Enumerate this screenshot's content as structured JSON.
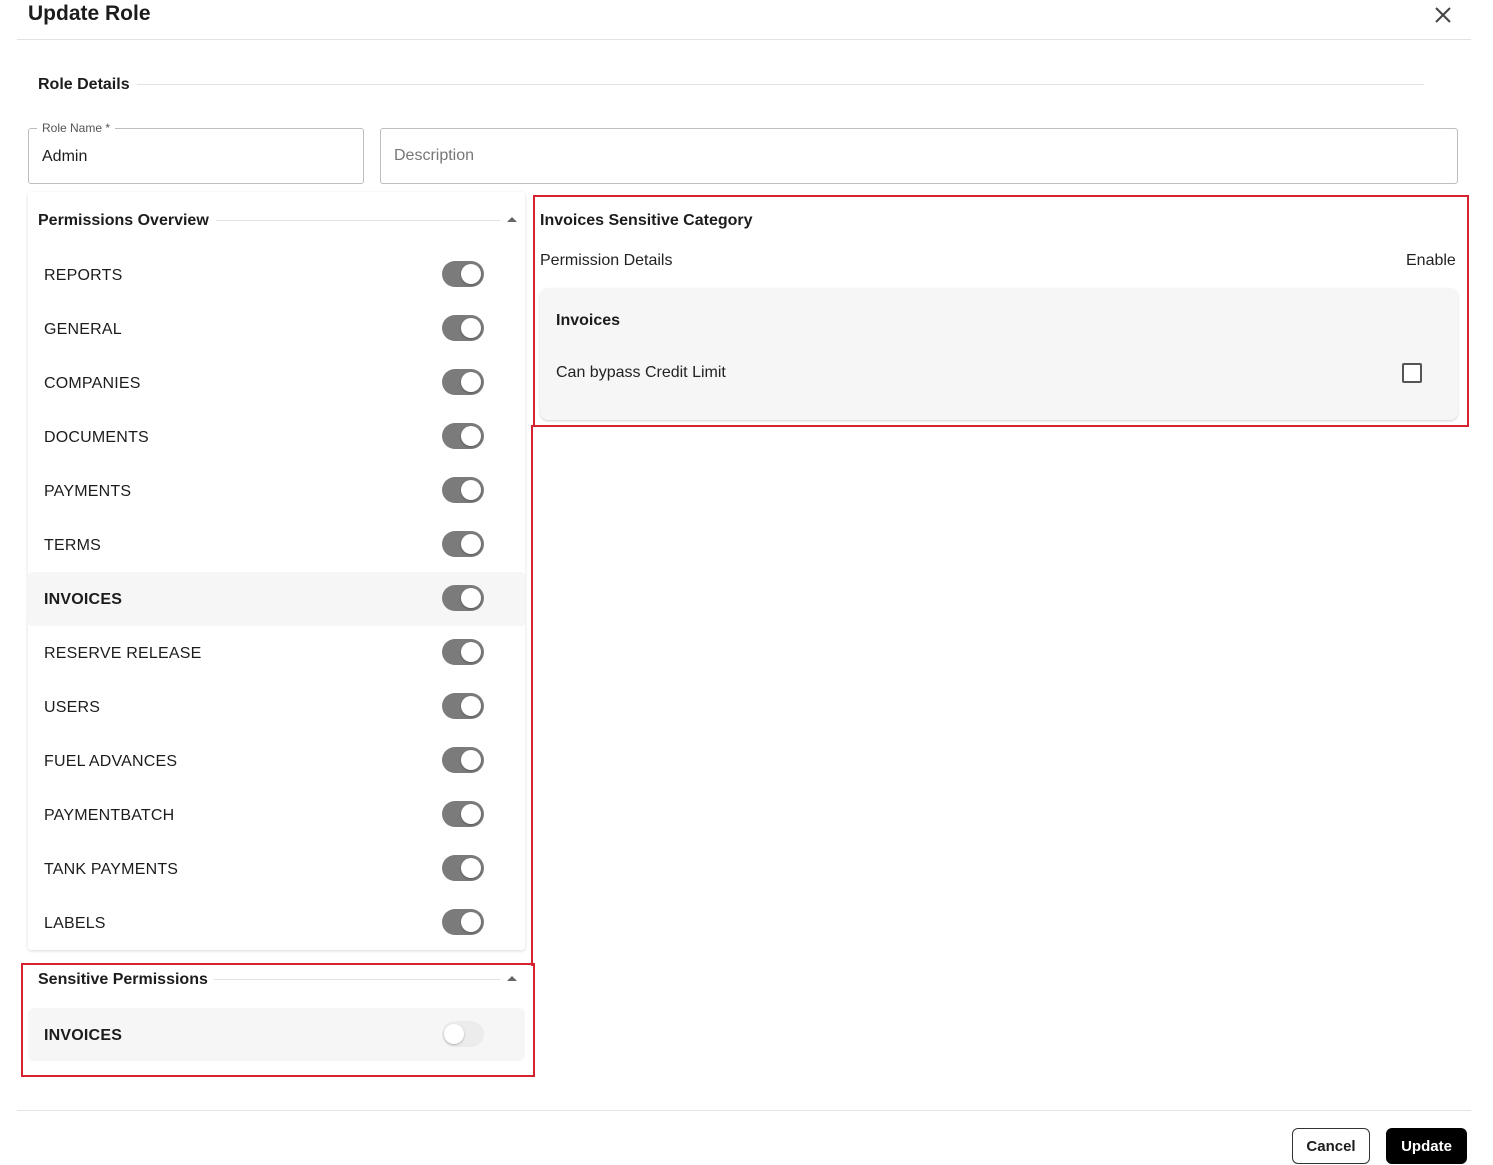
{
  "dialog": {
    "title": "Update Role",
    "close_icon": "close-icon"
  },
  "role_details": {
    "section_title": "Role Details",
    "role_name_label": "Role Name *",
    "role_name_value": "Admin",
    "description_placeholder": "Description"
  },
  "permissions_overview": {
    "title": "Permissions Overview",
    "items": [
      {
        "label": "REPORTS",
        "enabled": true
      },
      {
        "label": "GENERAL",
        "enabled": true
      },
      {
        "label": "COMPANIES",
        "enabled": true
      },
      {
        "label": "DOCUMENTS",
        "enabled": true
      },
      {
        "label": "PAYMENTS",
        "enabled": true
      },
      {
        "label": "TERMS",
        "enabled": true
      },
      {
        "label": "INVOICES",
        "enabled": true,
        "selected": true
      },
      {
        "label": "RESERVE RELEASE",
        "enabled": true
      },
      {
        "label": "USERS",
        "enabled": true
      },
      {
        "label": "FUEL ADVANCES",
        "enabled": true
      },
      {
        "label": "PAYMENTBATCH",
        "enabled": true
      },
      {
        "label": "TANK PAYMENTS",
        "enabled": true
      },
      {
        "label": "LABELS",
        "enabled": true
      }
    ]
  },
  "sensitive_permissions": {
    "title": "Sensitive Permissions",
    "items": [
      {
        "label": "INVOICES",
        "enabled": false,
        "selected": true
      }
    ]
  },
  "sensitive_category": {
    "title": "Invoices Sensitive Category",
    "details_label": "Permission Details",
    "enable_label": "Enable",
    "card_title": "Invoices",
    "item_label": "Can bypass Credit Limit",
    "item_checked": false
  },
  "footer": {
    "cancel_label": "Cancel",
    "update_label": "Update"
  },
  "colors": {
    "highlight_border": "#d62330",
    "toggle_on": "#7b7b7b",
    "toggle_off": "#ececec",
    "primary_button": "#000000"
  }
}
